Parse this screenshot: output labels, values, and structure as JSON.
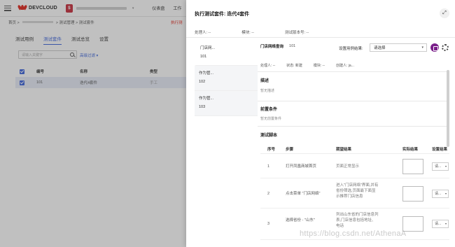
{
  "topbar": {
    "logo_text": "DEVCLOUD",
    "project_initial": "$",
    "nav": [
      "仪表盘",
      "工作"
    ]
  },
  "breadcrumb": {
    "home": "首页 >",
    "mid": "> 测试管理 > 测试套件"
  },
  "exec_link": "执行测",
  "tabs": [
    "测试用例",
    "测试套件",
    "测试总览",
    "设置"
  ],
  "search": {
    "placeholder": "请输入关键字"
  },
  "adv_filter": "高级过滤 ▾",
  "table": {
    "headers": [
      "编号",
      "名称",
      "类型"
    ],
    "rows": [
      {
        "id": "101",
        "name": "迭代4套件",
        "type": "手工"
      }
    ]
  },
  "drawer": {
    "title": "执行测试套件: 迭代4套件",
    "meta": [
      "处理人: --",
      "模块: --",
      "测试版本号: --"
    ],
    "cases": [
      {
        "title": "门店网...",
        "id": "101"
      },
      {
        "title": "作为管...",
        "id": "102"
      },
      {
        "title": "作为管...",
        "id": "103"
      }
    ],
    "detail": {
      "name": "门店网络查询",
      "number": "101",
      "result_label": "设置用例结果:",
      "result_value": "请选择",
      "info": [
        "处理人: --",
        "状态: 新建",
        "模块: --",
        "创建人: ja..."
      ],
      "desc_title": "描述",
      "desc_text": "暂无描述",
      "pre_title": "前置条件",
      "pre_text": "暂无前置条件",
      "script_title": "测试脚本",
      "step_headers": [
        "序号",
        "步骤",
        "期望结果",
        "实际结果",
        "设置结果"
      ],
      "steps": [
        {
          "no": "1",
          "step": "打开凤凰商城首页",
          "expected": "页面正常显示",
          "result": "请..."
        },
        {
          "no": "2",
          "step": "点击菜单 \"门店网络\"",
          "expected": "进入\"门店网络\"界面,并有省份筛选,页面最下面显示推荐门店信息",
          "result": "请..."
        },
        {
          "no": "3",
          "step": "选择省份 - \"山东\"",
          "expected": "列出山东省的门店信息列表,门店信息包括地址、电话",
          "result": "请..."
        }
      ]
    }
  },
  "watermark": "https://blog.csdn.net/AthenaA"
}
